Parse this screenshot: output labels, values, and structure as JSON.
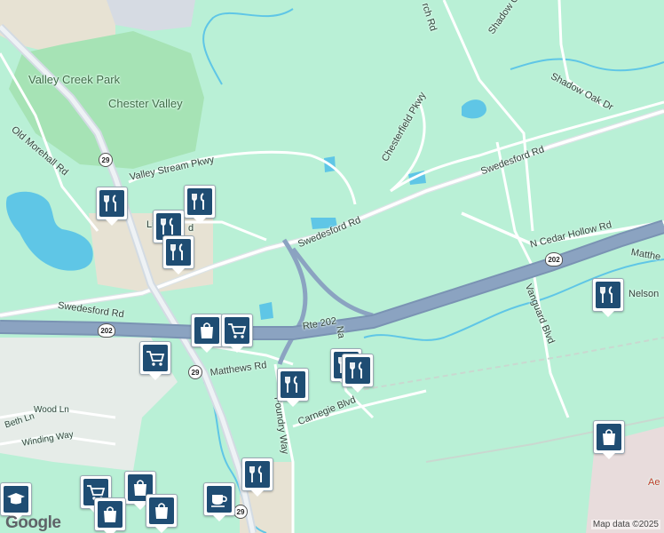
{
  "map": {
    "colors": {
      "land": "#b9f0d6",
      "park": "#a6e3b5",
      "water": "#5fc6e6",
      "urban": "#e7e2d3",
      "highway": "#8ba3c1",
      "road": "#ffffff",
      "pin": "#1f4d73"
    },
    "labels": {
      "valley_creek_park": "Valley Creek Park",
      "chester_valley": "Chester Valley",
      "old_morehall_rd": "Old Morehall Rd",
      "valley_stream_pkwy": "Valley Stream Pkwy",
      "chesterfield_pkwy": "Chesterfield Pkwy",
      "swedesford_rd_east": "Swedesford Rd",
      "swedesford_rd_mid": "Swedesford Rd",
      "swedesford_rd_west": "Swedesford Rd",
      "n_cedar_hollow_rd": "N Cedar Hollow Rd",
      "shadow_oak_dr": "Shadow Oak Dr",
      "shadow_oak_top": "Shadow Oa",
      "church_rd": "rch Rd",
      "matthews_rd_west": "Matthews Rd",
      "matthews_rd_east": "Matthe",
      "nelson": "Nelson",
      "vanguard_blvd": "Vanguard Blvd",
      "rte_202": "Rte 202",
      "foundry_way": "Foundry Way",
      "carnegie_blvd": "Carnegie Blvd",
      "liberty_blvd": "Lib",
      "liberty_blvd_end": "d",
      "na": "Na",
      "wood_ln": "Wood Ln",
      "beth_ln": "Beth Ln",
      "winding_way": "Winding Way",
      "aer": "Ae"
    },
    "shields": {
      "route_29_a": "29",
      "route_29_b": "29",
      "route_29_c": "29",
      "route_202_a": "202",
      "route_202_b": "202"
    },
    "logo": "Google",
    "attribution": "Map data ©2025"
  }
}
